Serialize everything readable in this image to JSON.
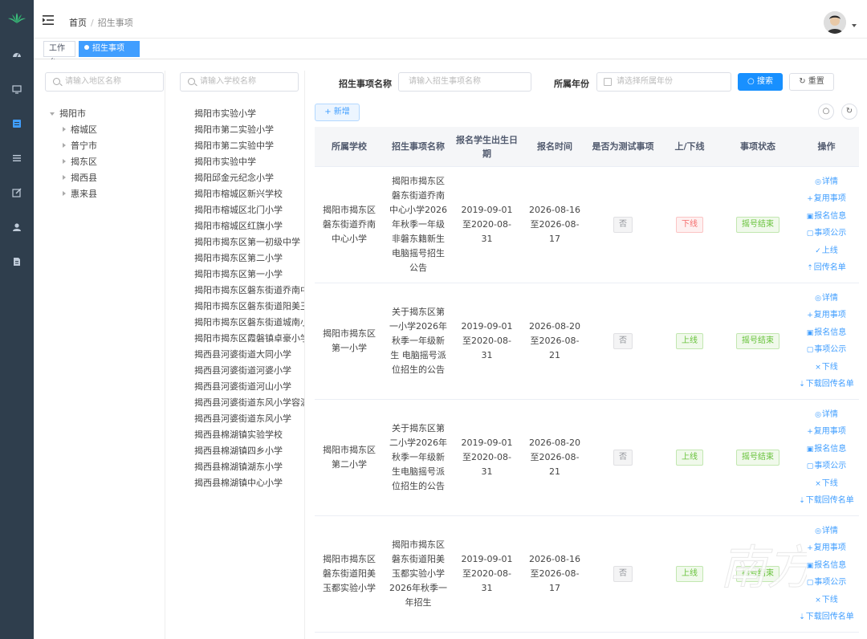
{
  "header": {
    "breadcrumb_home": "首页",
    "breadcrumb_sep": "/",
    "breadcrumb_current": "招生事项"
  },
  "tags": {
    "workbench": "工作台",
    "current": "招生事项",
    "close": "×"
  },
  "sidebar": {
    "icons": [
      "dashboard-icon",
      "monitor-icon",
      "school-icon",
      "list-icon",
      "edit-icon",
      "user-icon",
      "document-icon"
    ]
  },
  "region": {
    "placeholder": "请输入地区名称",
    "root": "揭阳市",
    "children": [
      "榕城区",
      "普宁市",
      "揭东区",
      "揭西县",
      "惠来县"
    ]
  },
  "school": {
    "placeholder": "请输入学校名称",
    "items": [
      "揭阳市实验小学",
      "揭阳市第二实验小学",
      "揭阳市第二实验中学",
      "揭阳市实验中学",
      "揭阳邱金元纪念小学",
      "揭阳市榕城区新兴学校",
      "揭阳市榕城区北门小学",
      "揭阳市榕城区红旗小学",
      "揭阳市揭东区第一初级中学",
      "揭阳市揭东区第二小学",
      "揭阳市揭东区第一小学",
      "揭阳市揭东区磐东街道乔南中",
      "揭阳市揭东区磐东街道阳美王",
      "揭阳市揭东区磐东街道城南小",
      "揭阳市揭东区霞磐镇卓豪小学",
      "揭西县河婆街道大同小学",
      "揭西县河婆街道河婆小学",
      "揭西县河婆街道河山小学",
      "揭西县河婆街道东风小学容满",
      "揭西县河婆街道东风小学",
      "揭西县棉湖镇实验学校",
      "揭西县棉湖镇四乡小学",
      "揭西县棉湖镇湖东小学",
      "揭西县棉湖镇中心小学"
    ]
  },
  "filters": {
    "name_label": "招生事项名称",
    "name_placeholder": "请输入招生事项名称",
    "year_label": "所属年份",
    "year_placeholder": "请选择所属年份",
    "search_label": "搜索",
    "reset_label": "重置",
    "add_label": "+ 新增"
  },
  "table": {
    "headers": [
      "所属学校",
      "招生事项名称",
      "报名学生出生日期",
      "报名时间",
      "是否为测试事项",
      "上/下线",
      "事项状态",
      "操作"
    ],
    "rows": [
      {
        "school": "揭阳市揭东区磐东街道乔南中心小学",
        "name": "揭阳市揭东区磐东街道乔南中心小学2026年秋季一年级非磐东籍新生电脑摇号招生公告",
        "birth": "2019-09-01至2020-08-31",
        "time": "2026-08-16至2026-08-17",
        "test": "否",
        "online": "下线",
        "status": "摇号结束",
        "ops": [
          "详情",
          "复用事项",
          "报名信息",
          "事项公示",
          "上线",
          "回传名单"
        ]
      },
      {
        "school": "揭阳市揭东区第一小学",
        "name": "关于揭东区第一小学2026年秋季一年级新生 电脑摇号派位招生的公告",
        "birth": "2019-09-01至2020-08-31",
        "time": "2026-08-20至2026-08-21",
        "test": "否",
        "online": "上线",
        "status": "摇号结束",
        "ops": [
          "详情",
          "复用事项",
          "报名信息",
          "事项公示",
          "下线",
          "下载回传名单"
        ]
      },
      {
        "school": "揭阳市揭东区第二小学",
        "name": "关于揭东区第二小学2026年秋季一年级新生电脑摇号派位招生的公告",
        "birth": "2019-09-01至2020-08-31",
        "time": "2026-08-20至2026-08-21",
        "test": "否",
        "online": "上线",
        "status": "摇号结束",
        "ops": [
          "详情",
          "复用事项",
          "报名信息",
          "事项公示",
          "下线",
          "下载回传名单"
        ]
      },
      {
        "school": "揭阳市揭东区磐东街道阳美玉都实验小学",
        "name": "揭阳市揭东区磐东街道阳美玉都实验小学2026年秋季一年招生",
        "birth": "2019-09-01至2020-08-31",
        "time": "2026-08-16至2026-08-17",
        "test": "否",
        "online": "上线",
        "status": "摇号结束",
        "ops": [
          "详情",
          "复用事项",
          "报名信息",
          "事项公示",
          "下线",
          "下载回传名单"
        ]
      }
    ]
  },
  "watermark": "南方"
}
